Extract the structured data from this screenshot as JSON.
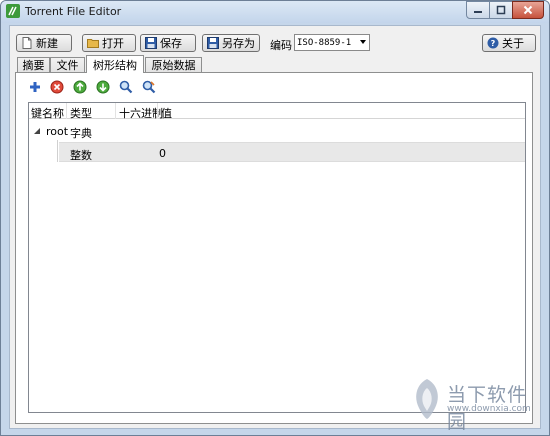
{
  "window": {
    "title": "Torrent File Editor"
  },
  "toolbar": {
    "new_label": "新建",
    "open_label": "打开",
    "save_label": "保存",
    "save_as_label": "另存为",
    "encoding_label": "编码",
    "encoding_value": "ISO-8859-1",
    "about_label": "关于"
  },
  "tabs": [
    {
      "label": "摘要"
    },
    {
      "label": "文件"
    },
    {
      "label": "树形结构",
      "active": true
    },
    {
      "label": "原始数据"
    }
  ],
  "panel_icons": [
    "add-icon",
    "remove-icon",
    "move-up-icon",
    "move-down-icon",
    "search-icon",
    "search-replace-icon"
  ],
  "tree": {
    "columns": [
      "键名称",
      "类型",
      "十六进制",
      "值"
    ],
    "rows": [
      {
        "key": "root",
        "type": "字典",
        "hex": "",
        "value": ""
      },
      {
        "key": "",
        "type": "整数",
        "hex": "",
        "value": "0"
      }
    ]
  },
  "watermark": {
    "brand": "当下软件园",
    "url": "www.downxia.com"
  }
}
